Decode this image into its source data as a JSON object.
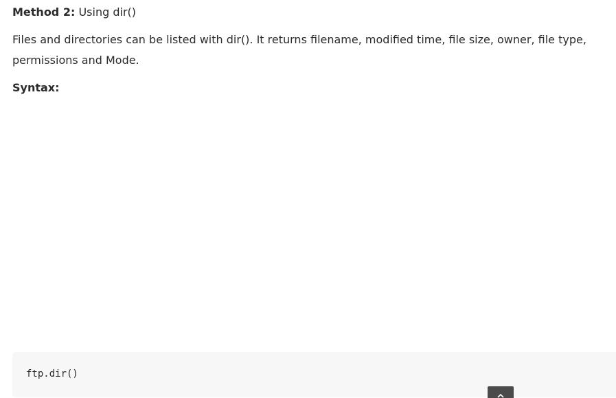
{
  "method": {
    "label": "Method 2:",
    "text": " Using dir()"
  },
  "description": "Files and directories can be listed with dir(). It returns filename, modified time, file size, owner, file type, permissions and Mode.",
  "syntax_heading": "Syntax:",
  "code": {
    "line": "ftp.dir()"
  },
  "icons": {
    "scroll_top": "chevron-up-icon"
  },
  "colors": {
    "text": "#2b2b2b",
    "code_background": "#f7f7f7",
    "button_background": "#4a4a4a"
  }
}
